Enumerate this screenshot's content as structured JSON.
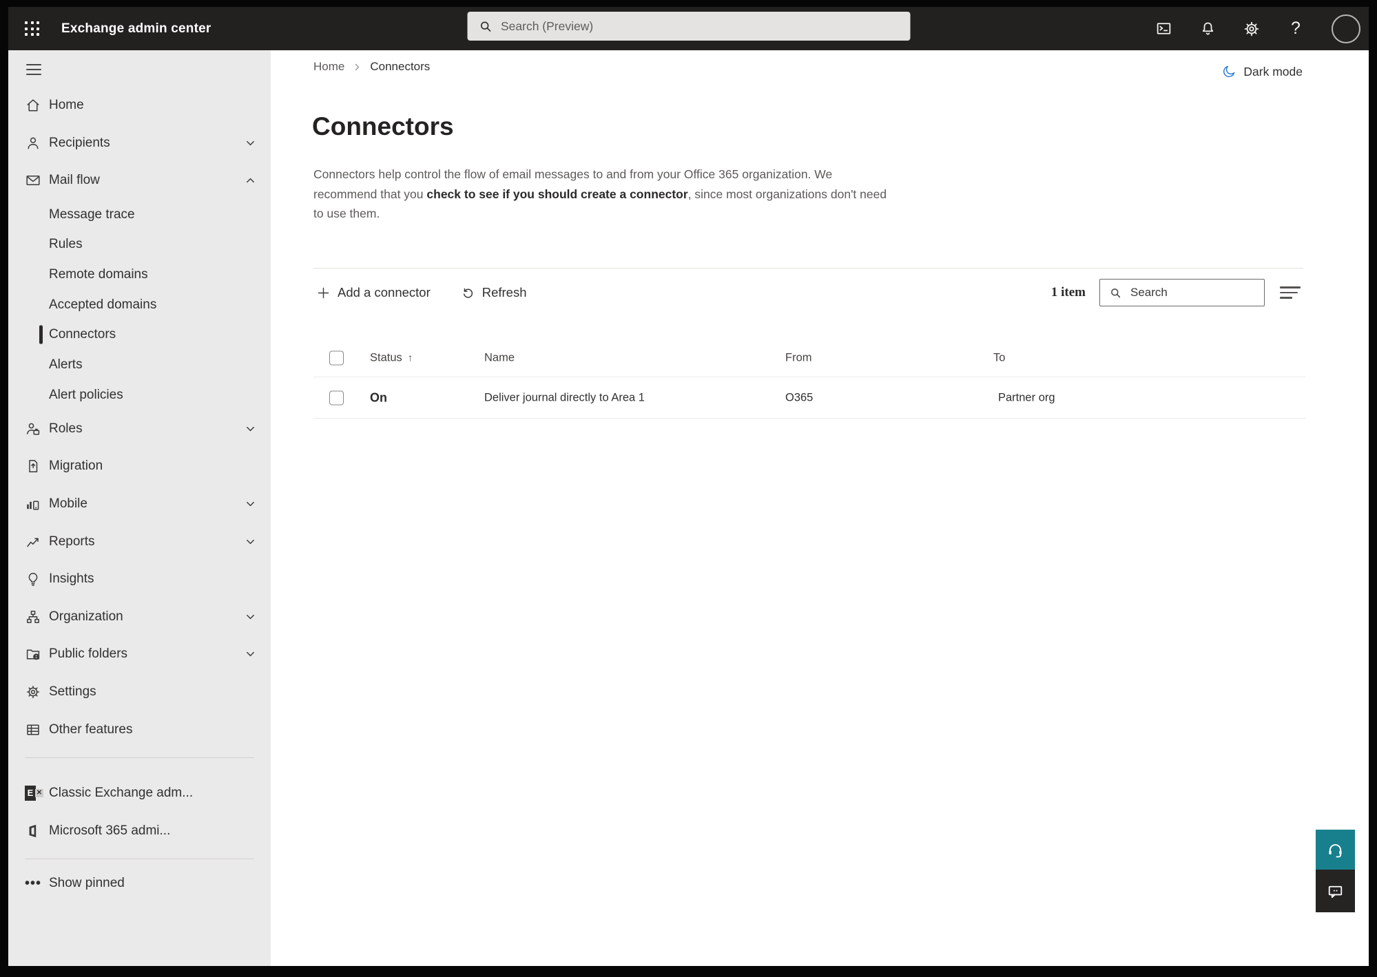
{
  "topbar": {
    "app_title": "Exchange admin center",
    "search_placeholder": "Search (Preview)"
  },
  "sidebar": {
    "items": [
      {
        "label": "Home"
      },
      {
        "label": "Recipients"
      },
      {
        "label": "Mail flow"
      },
      {
        "label": "Message trace"
      },
      {
        "label": "Rules"
      },
      {
        "label": "Remote domains"
      },
      {
        "label": "Accepted domains"
      },
      {
        "label": "Connectors"
      },
      {
        "label": "Alerts"
      },
      {
        "label": "Alert policies"
      },
      {
        "label": "Roles"
      },
      {
        "label": "Migration"
      },
      {
        "label": "Mobile"
      },
      {
        "label": "Reports"
      },
      {
        "label": "Insights"
      },
      {
        "label": "Organization"
      },
      {
        "label": "Public folders"
      },
      {
        "label": "Settings"
      },
      {
        "label": "Other features"
      },
      {
        "label": "Classic Exchange adm..."
      },
      {
        "label": "Microsoft 365 admi..."
      },
      {
        "label": "Show pinned"
      }
    ]
  },
  "main": {
    "breadcrumb": {
      "home": "Home",
      "current": "Connectors"
    },
    "dark_mode_label": "Dark mode",
    "page_title": "Connectors",
    "description": {
      "pre": "Connectors help control the flow of email messages to and from your Office 365 organization. We recommend that you ",
      "link": "check to see if you should create a connector",
      "post": ", since most organizations don't need to use them."
    },
    "toolbar": {
      "add_label": "Add a connector",
      "refresh_label": "Refresh",
      "item_count": "1 item",
      "search_placeholder": "Search"
    },
    "table": {
      "columns": [
        "Status",
        "Name",
        "From",
        "To"
      ],
      "rows": [
        {
          "status": "On",
          "name": "Deliver journal directly to Area 1",
          "from": "O365",
          "to": "Partner org"
        }
      ]
    }
  },
  "colors": {
    "topbar_bg": "#232120",
    "sidebar_bg": "#eaeaea",
    "selected_indicator": "#2b2a29",
    "moon_blue": "#2e7cd6",
    "help_teal": "#18808d",
    "feedback_dark": "#252423",
    "text_primary": "#323130",
    "text_secondary": "#5d5b59"
  }
}
